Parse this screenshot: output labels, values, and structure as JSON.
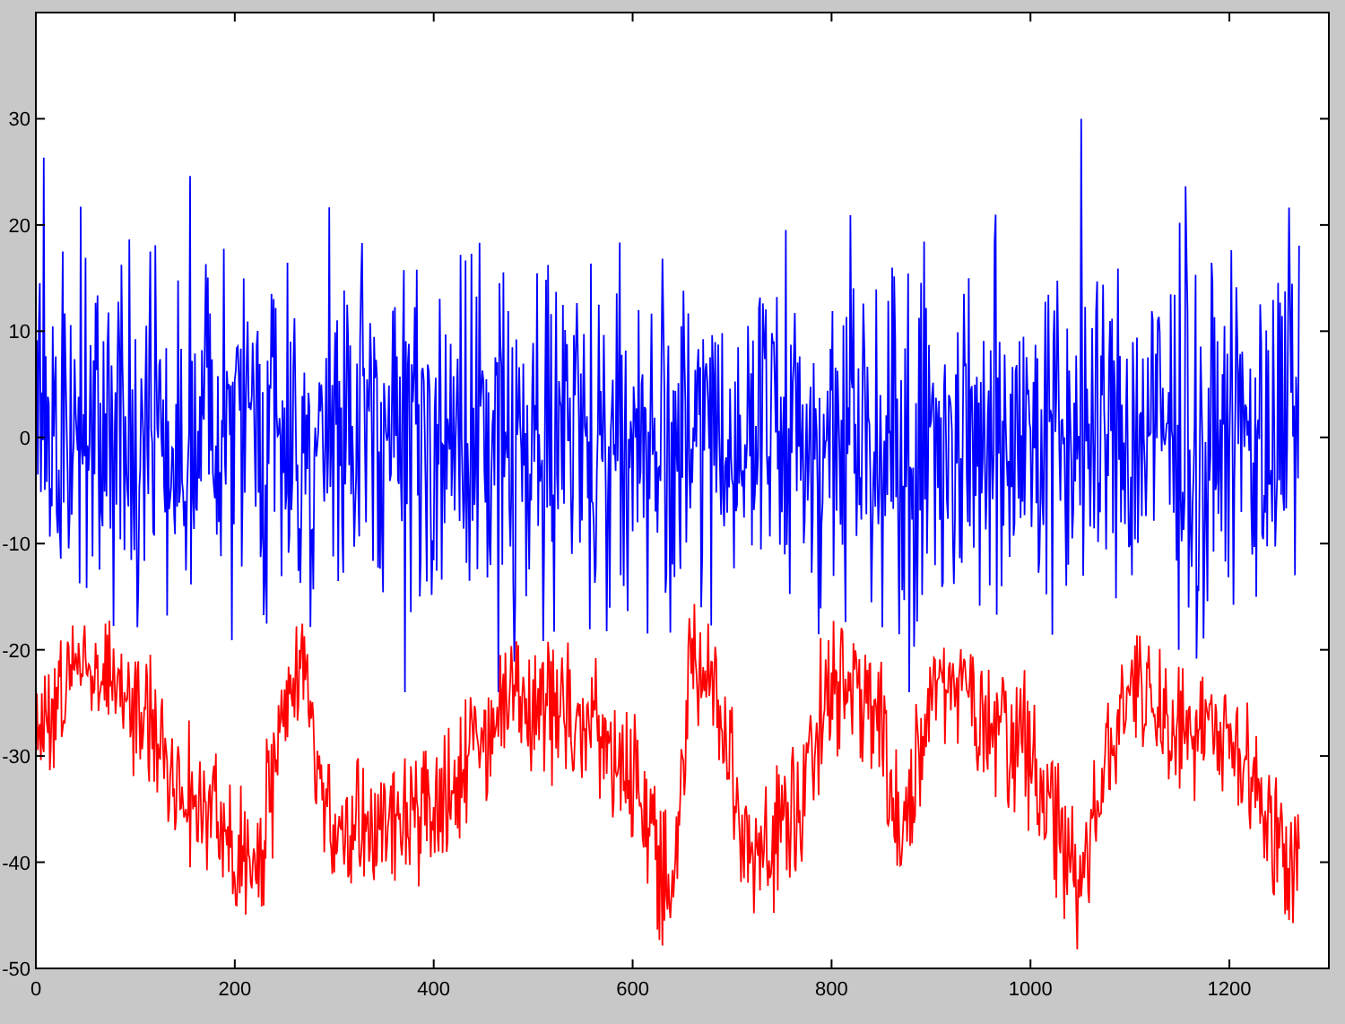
{
  "plot": {
    "y_ticks": [
      "30",
      "20",
      "10",
      "0",
      "-10",
      "-20",
      "-30",
      "-40",
      "-50"
    ],
    "x_ticks": [
      "0",
      "200",
      "400",
      "600",
      "800",
      "1000",
      "1200"
    ],
    "series": [
      {
        "color": "#0000ff"
      },
      {
        "color": "#ff0000"
      }
    ]
  }
}
